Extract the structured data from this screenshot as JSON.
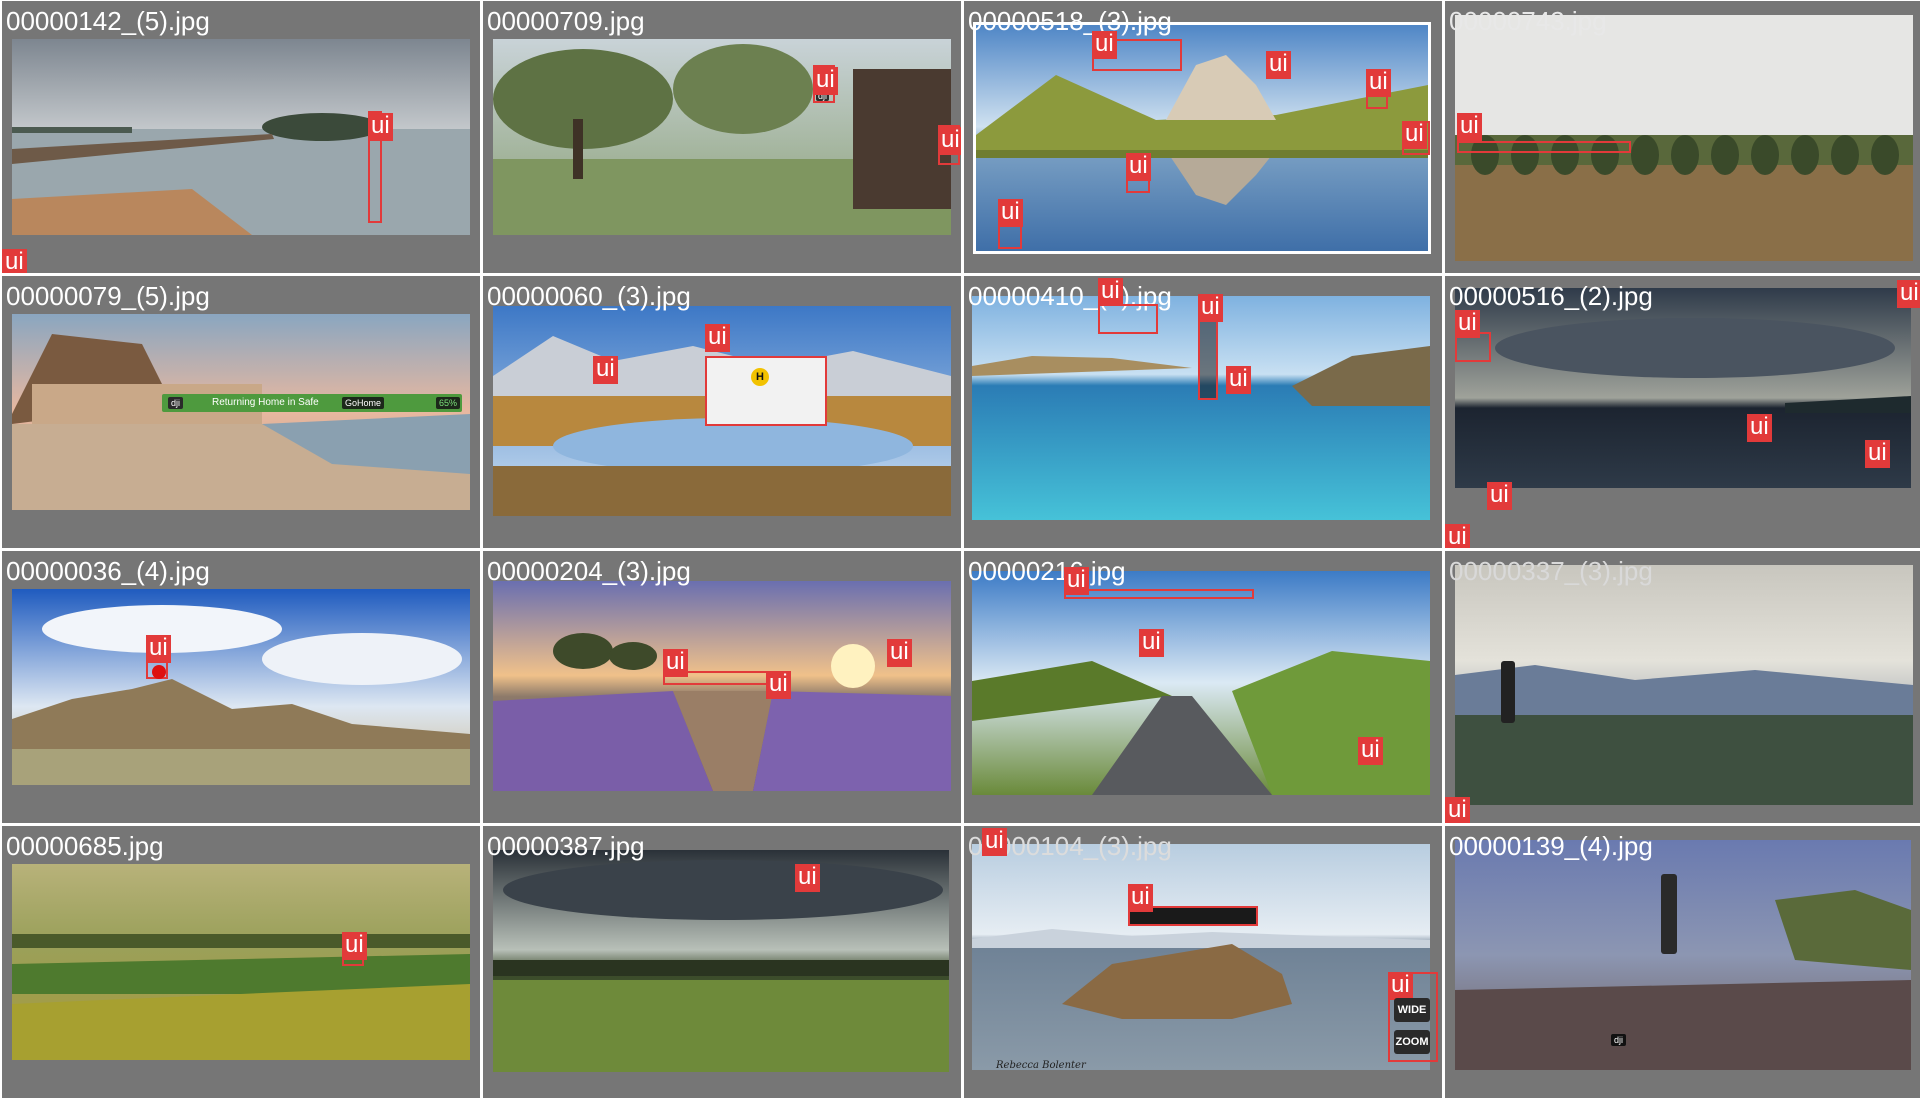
{
  "grid": {
    "tiles": [
      {
        "filename": "00000142_(5).jpg"
      },
      {
        "filename": "00000709.jpg"
      },
      {
        "filename": "00000518_(3).jpg"
      },
      {
        "filename": "00000743.jpg"
      },
      {
        "filename": "00000079_(5).jpg"
      },
      {
        "filename": "00000060_(3).jpg"
      },
      {
        "filename": "00000410_(2).jpg"
      },
      {
        "filename": "00000516_(2).jpg"
      },
      {
        "filename": "00000036_(4).jpg"
      },
      {
        "filename": "00000204_(3).jpg"
      },
      {
        "filename": "00000216.jpg"
      },
      {
        "filename": "00000337_(3).jpg"
      },
      {
        "filename": "00000685.jpg"
      },
      {
        "filename": "00000387.jpg"
      },
      {
        "filename": "00000104_(3).jpg"
      },
      {
        "filename": "00000139_(4).jpg"
      }
    ]
  },
  "annotation": {
    "label": "ui",
    "color": "#e23a3a"
  },
  "overlay_text": {
    "returning_home": "Returning Home in Safe",
    "gohome": "GoHome",
    "battery": "65%",
    "wide": "WIDE",
    "zoom": "ZOOM",
    "signature": "Rebecca Bolenter",
    "heli_h": "H",
    "dji": "dji"
  },
  "colors": {
    "tile_bg": "#767676",
    "page_bg": "#ffffff"
  }
}
